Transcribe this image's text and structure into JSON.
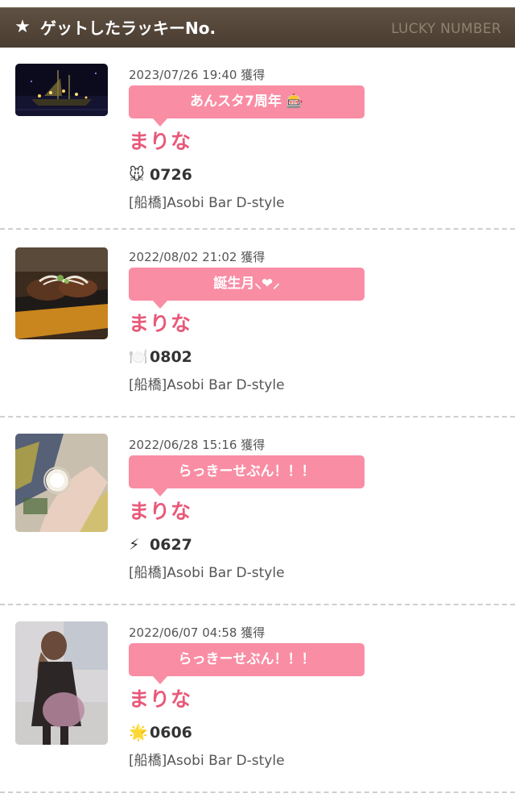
{
  "header": {
    "icon": "star-icon",
    "title": "ゲットしたラッキーNo.",
    "subtitle": "LUCKY NUMBER"
  },
  "entries": [
    {
      "date": "2023/07/26 19:40 獲得",
      "bubble": "あんスタ7周年 🎰",
      "name": "まりな",
      "emoji": "🐭",
      "number": "0726",
      "shop": "[船橋]Asobi Bar D-style"
    },
    {
      "date": "2022/08/02 21:02 獲得",
      "bubble": "誕生月⸜❤︎⸝",
      "name": "まりな",
      "emoji": "🍽️",
      "number": "0802",
      "shop": "[船橋]Asobi Bar D-style"
    },
    {
      "date": "2022/06/28 15:16 獲得",
      "bubble": "らっきーせぶん！！！",
      "name": "まりな",
      "emoji": "⚡",
      "number": "0627",
      "shop": "[船橋]Asobi Bar D-style"
    },
    {
      "date": "2022/06/07 04:58 獲得",
      "bubble": "らっきーせぶん！！！",
      "name": "まりな",
      "emoji": "🌟",
      "number": "0606",
      "shop": "[船橋]Asobi Bar D-style"
    }
  ]
}
